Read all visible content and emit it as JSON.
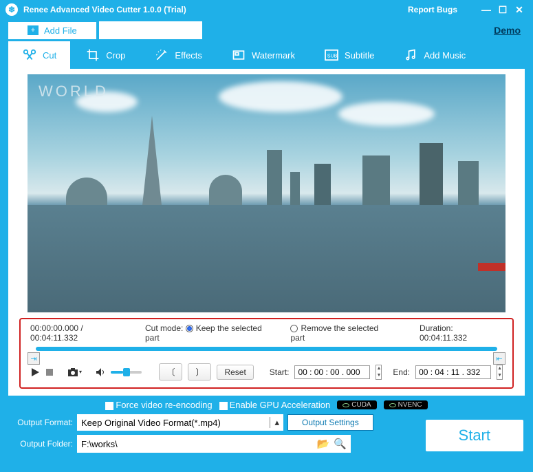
{
  "title": "Renee Advanced Video Cutter 1.0.0 (Trial)",
  "report_bugs": "Report Bugs",
  "add_file": "Add File",
  "demo": "Demo",
  "tabs": {
    "cut": "Cut",
    "crop": "Crop",
    "effects": "Effects",
    "watermark": "Watermark",
    "subtitle": "Subtitle",
    "addmusic": "Add Music"
  },
  "watermark_text": "WORLD",
  "controls": {
    "pos_time": "00:00:00.000 / 00:04:11.332",
    "cut_mode_label": "Cut mode:",
    "keep": "Keep the selected part",
    "remove": "Remove the selected part",
    "duration_label": "Duration: 00:04:11.332",
    "reset": "Reset",
    "start_label": "Start:",
    "start_value": "00 : 00 : 00 . 000",
    "end_label": "End:",
    "end_value": "00 : 04 : 11 . 332"
  },
  "options": {
    "force": "Force video re-encoding",
    "gpu": "Enable GPU Acceleration",
    "cuda": "CUDA",
    "nvenc": "NVENC"
  },
  "output": {
    "format_label": "Output Format:",
    "format_value": "Keep Original Video Format(*.mp4)",
    "settings": "Output Settings",
    "folder_label": "Output Folder:",
    "folder_value": "F:\\works\\",
    "start": "Start"
  }
}
